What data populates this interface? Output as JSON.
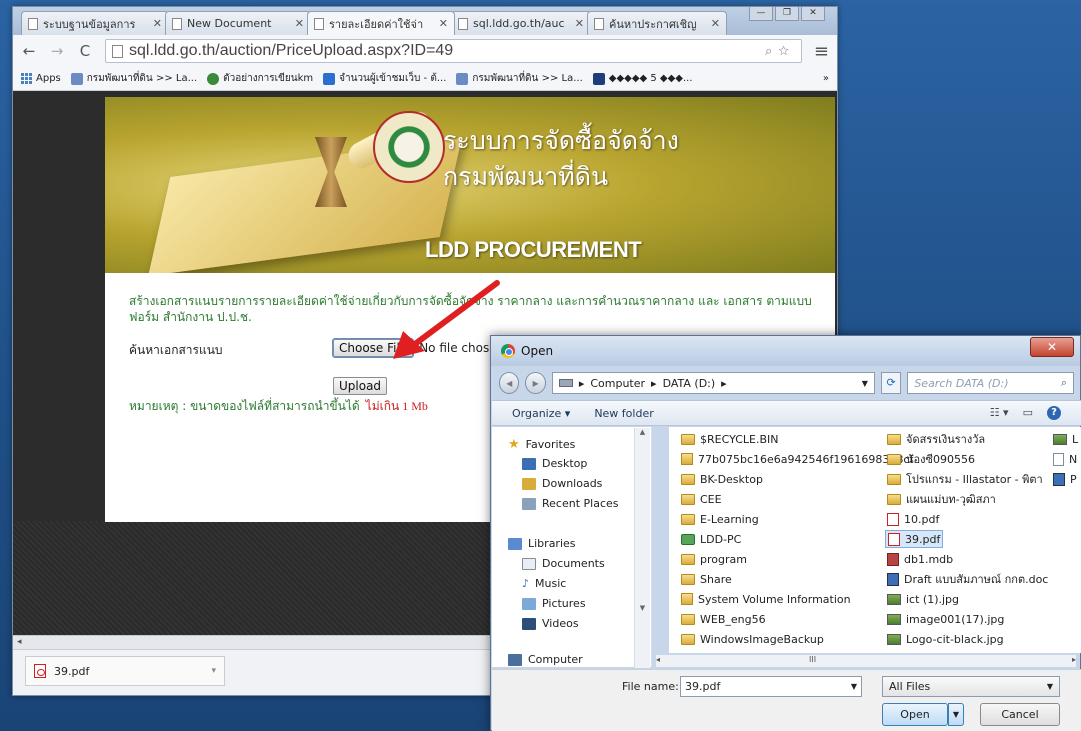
{
  "browser": {
    "tabs": [
      {
        "label": "ระบบฐานข้อมูลการ"
      },
      {
        "label": "New Document"
      },
      {
        "label": "รายละเอียดค่าใช้จ่า"
      },
      {
        "label": "sql.ldd.go.th/auc"
      },
      {
        "label": "ค้นหาประกาศเชิญ"
      }
    ],
    "url": "sql.ldd.go.th/auction/PriceUpload.aspx?ID=49",
    "bookmarks": [
      {
        "label": "Apps"
      },
      {
        "label": "กรมพัฒนาที่ดิน >> La..."
      },
      {
        "label": "ตัวอย่างการเขียนkm"
      },
      {
        "label": "จำนวนผู้เข้าชมเว็บ - ต้..."
      },
      {
        "label": "กรมพัฒนาที่ดิน >> La..."
      },
      {
        "label": "◆◆◆◆◆ 5 ◆◆◆..."
      }
    ],
    "bookmarks_more": "»",
    "download_item": "39.pdf"
  },
  "banner": {
    "title_line1": "ระบบการจัดซื้อจัดจ้าง",
    "title_line2": "กรมพัฒนาที่ดิน",
    "subtitle": "LDD PROCUREMENT"
  },
  "form": {
    "description": "สร้างเอกสารแนบรายการรายละเอียดค่าใช้จ่ายเกี่ยวกับการจัดซื้อจัดจ้าง ราคากลาง และการคำนวณราคากลาง และ เอกสาร ตามแบบฟอร์ม สำนักงาน ป.ป.ช.",
    "search_label": "ค้นหาเอกสารแนบ",
    "choose_file_label": "Choose File",
    "no_file_text": "No file chosen",
    "upload_label": "Upload",
    "note_prefix": "หมายเหตุ : ขนาดของไฟล์ที่สามารถนำขึ้นได้",
    "note_limit": "ไม่เกิน 1 Mb"
  },
  "dialog": {
    "title": "Open",
    "breadcrumb": [
      "Computer",
      "DATA (D:)"
    ],
    "search_placeholder": "Search DATA (D:)",
    "organize_label": "Organize ▾",
    "new_folder_label": "New folder",
    "nav": {
      "favorites": "Favorites",
      "favorites_items": [
        "Desktop",
        "Downloads",
        "Recent Places"
      ],
      "libraries": "Libraries",
      "libraries_items": [
        "Documents",
        "Music",
        "Pictures",
        "Videos"
      ],
      "computer": "Computer"
    },
    "files_col1": [
      "$RECYCLE.BIN",
      "77b075bc16e6a942546f19616983b8cf",
      "BK-Desktop",
      "CEE",
      "E-Learning",
      "LDD-PC",
      "program",
      "Share",
      "System Volume Information",
      "WEB_eng56",
      "WindowsImageBackup"
    ],
    "files_col2": [
      "จัดสรรเงินรางวัล",
      "น้องซี090556",
      "โปรแกรม - Illastator - พิตา",
      "แผนแม่บท-วุฒิสภา",
      "10.pdf",
      "39.pdf",
      "db1.mdb",
      "Draft แบบสัมภาษณ์ กกต.doc",
      "ict (1).jpg",
      "image001(17).jpg",
      "Logo-cit-black.jpg"
    ],
    "files_col3": [
      "L",
      "N",
      "P"
    ],
    "file_name_label": "File name:",
    "file_name_value": "39.pdf",
    "file_type_value": "All Files",
    "open_label": "Open",
    "cancel_label": "Cancel",
    "selected_file": "39.pdf"
  },
  "colors": {
    "accent_green": "#2b7a2f",
    "limit_red": "#c81d1d",
    "arrow_red": "#e02020"
  }
}
